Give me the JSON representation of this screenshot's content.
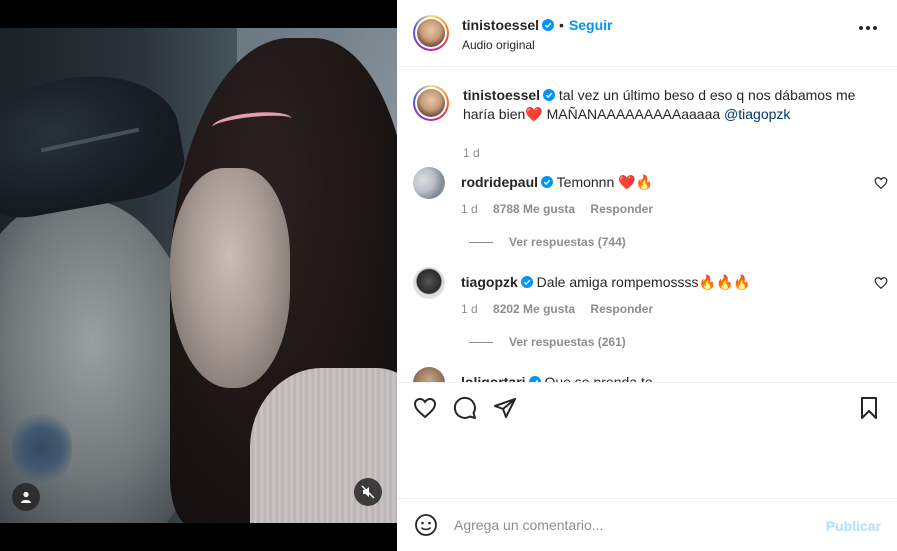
{
  "header": {
    "username": "tinistoessel",
    "separator": "•",
    "follow_label": "Seguir",
    "audio": "Audio original"
  },
  "caption": {
    "username": "tinistoessel",
    "text_part1": "tal vez un último beso d eso q nos dábamos me haría bien",
    "heart": "❤️",
    "text_part2": " MAÑANAAAAAAAAAaaaaa ",
    "mention": "@tiagopzk",
    "time": "1 d"
  },
  "comments": [
    {
      "username": "rodridepaul",
      "text": "Temonnn ",
      "emojis": "❤️🔥",
      "time": "1 d",
      "likes": "8788 Me gusta",
      "reply": "Responder",
      "view_replies": "Ver respuestas (744)"
    },
    {
      "username": "tiagopzk",
      "text": "Dale amiga rompemossss",
      "emojis": "🔥🔥🔥",
      "time": "1 d",
      "likes": "8202 Me gusta",
      "reply": "Responder",
      "view_replies": "Ver respuestas (261)"
    },
    {
      "username": "loligortari",
      "text": "Que se prenda to"
    }
  ],
  "add_comment": {
    "placeholder": "Agrega un comentario...",
    "publish": "Publicar"
  },
  "icons": {
    "like": "heart-icon",
    "comment": "speech-bubble-icon",
    "share": "paper-plane-icon",
    "save": "bookmark-icon",
    "emoji": "smiley-icon",
    "more": "more-options-icon",
    "user_tag": "user-icon",
    "mute": "muted-speaker-icon"
  },
  "colors": {
    "accent": "#0095f6",
    "verified": "#0095f6",
    "publish_disabled": "#b2dffc"
  }
}
